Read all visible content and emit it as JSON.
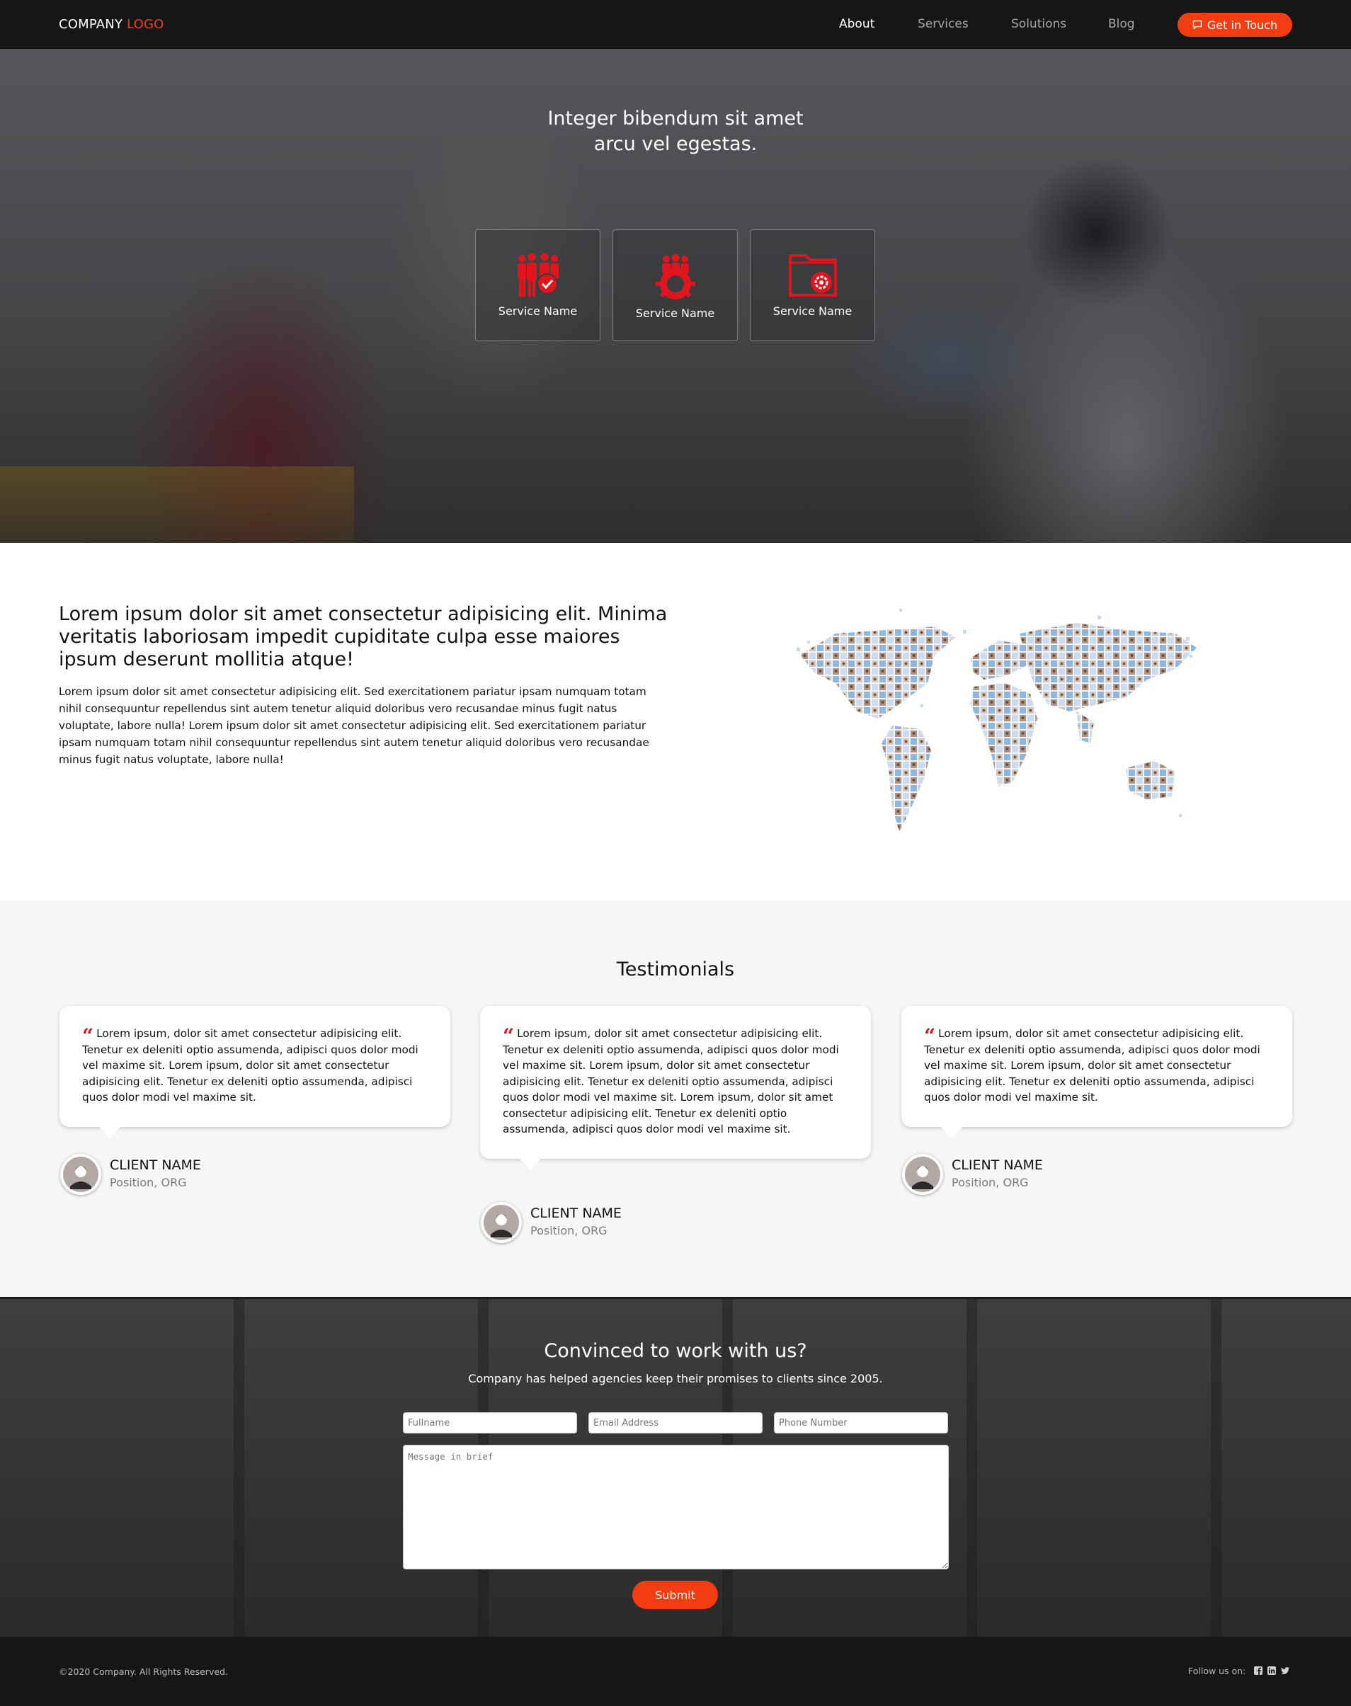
{
  "nav": {
    "logo_main": "COMPANY",
    "logo_accent": "LOGO",
    "links": [
      "About",
      "Services",
      "Solutions",
      "Blog"
    ],
    "active": "About",
    "cta": "Get in Touch"
  },
  "hero": {
    "title": "Integer bibendum sit amet\narcu vel egestas.",
    "services": [
      {
        "label": "Service Name",
        "icon": "team-check-icon"
      },
      {
        "label": "Service Name",
        "icon": "team-gear-icon"
      },
      {
        "label": "Service Name",
        "icon": "folder-gear-icon"
      }
    ]
  },
  "about": {
    "heading": "Lorem ipsum dolor sit amet consectetur adipisicing elit. Minima veritatis laboriosam impedit cupiditate culpa esse maiores ipsum deserunt mollitia atque!",
    "body": "Lorem ipsum dolor sit amet consectetur adipisicing elit. Sed exercitationem pariatur ipsam numquam totam nihil consequuntur repellendus sint autem tenetur aliquid doloribus vero recusandae minus fugit natus voluptate, labore nulla! Lorem ipsum dolor sit amet consectetur adipisicing elit. Sed exercitationem pariatur ipsam numquam totam nihil consequuntur repellendus sint autem tenetur aliquid doloribus vero recusandae minus fugit natus voluptate, labore nulla!",
    "image": "world-map-of-faces"
  },
  "testimonials": {
    "title": "Testimonials",
    "items": [
      {
        "quote": "Lorem ipsum, dolor sit amet consectetur adipisicing elit. Tenetur ex deleniti optio assumenda, adipisci quos dolor modi vel maxime sit. Lorem ipsum, dolor sit amet consectetur adipisicing elit. Tenetur ex deleniti optio assumenda, adipisci quos dolor modi vel maxime sit.",
        "name": "CLIENT NAME",
        "position": "Position, ORG"
      },
      {
        "quote": "Lorem ipsum, dolor sit amet consectetur adipisicing elit. Tenetur ex deleniti optio assumenda, adipisci quos dolor modi vel maxime sit. Lorem ipsum, dolor sit amet consectetur adipisicing elit. Tenetur ex deleniti optio assumenda, adipisci quos dolor modi vel maxime sit. Lorem ipsum, dolor sit amet consectetur adipisicing elit. Tenetur ex deleniti optio assumenda, adipisci quos dolor modi vel maxime sit.",
        "name": "CLIENT NAME",
        "position": "Position, ORG"
      },
      {
        "quote": "Lorem ipsum, dolor sit amet consectetur adipisicing elit. Tenetur ex deleniti optio assumenda, adipisci quos dolor modi vel maxime sit. Lorem ipsum, dolor sit amet consectetur adipisicing elit. Tenetur ex deleniti optio assumenda, adipisci quos dolor modi vel maxime sit.",
        "name": "CLIENT NAME",
        "position": "Position, ORG"
      }
    ]
  },
  "contact": {
    "title": "Convinced to work with us?",
    "subtitle": "Company has helped agencies keep their promises to clients since 2005.",
    "fullname_placeholder": "Fullname",
    "email_placeholder": "Email Address",
    "phone_placeholder": "Phone Number",
    "message_placeholder": "Message in brief",
    "submit": "Submit"
  },
  "footer": {
    "copyright": "©2020 Company. All Rights Reserved.",
    "follow": "Follow us on:",
    "social": [
      "facebook-icon",
      "linkedin-icon",
      "twitter-icon"
    ]
  },
  "colors": {
    "accent": "#f23d12",
    "icon_red": "#e0161e",
    "nav_bg": "#161616",
    "testimonial_bg": "#f6f6f6"
  }
}
